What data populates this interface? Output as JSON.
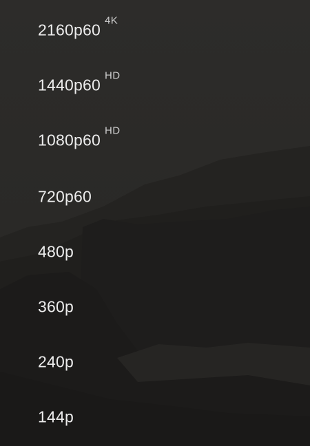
{
  "quality_menu": {
    "options": [
      {
        "label": "2160p60",
        "badge": "4K"
      },
      {
        "label": "1440p60",
        "badge": "HD"
      },
      {
        "label": "1080p60",
        "badge": "HD"
      },
      {
        "label": "720p60",
        "badge": ""
      },
      {
        "label": "480p",
        "badge": ""
      },
      {
        "label": "360p",
        "badge": ""
      },
      {
        "label": "240p",
        "badge": ""
      },
      {
        "label": "144p",
        "badge": ""
      }
    ]
  },
  "colors": {
    "panel_background": "#2a2927",
    "text": "#ececec",
    "badge_text": "#d0d0d0"
  }
}
